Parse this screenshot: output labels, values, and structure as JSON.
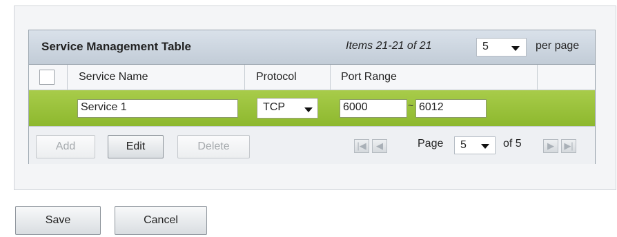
{
  "table": {
    "title": "Service Management Table",
    "items_text": "Items 21-21 of 21",
    "per_page_value": "5",
    "per_page_label": "per page",
    "columns": [
      "Service Name",
      "Protocol",
      "Port Range"
    ],
    "row": {
      "service_name": "Service 1",
      "protocol": "TCP",
      "port_start": "6000",
      "port_end": "6012",
      "selected": false
    },
    "row_highlight_color": "#98c23a",
    "actions": {
      "add": "Add",
      "edit": "Edit",
      "delete": "Delete"
    },
    "pagination": {
      "page_label": "Page",
      "page_value": "5",
      "of_label": "of 5"
    }
  },
  "form": {
    "save": "Save",
    "cancel": "Cancel"
  },
  "icons": {
    "first": "first-page-icon",
    "prev": "prev-page-icon",
    "next": "next-page-icon",
    "last": "last-page-icon",
    "dropdown": "chevron-down-icon"
  }
}
